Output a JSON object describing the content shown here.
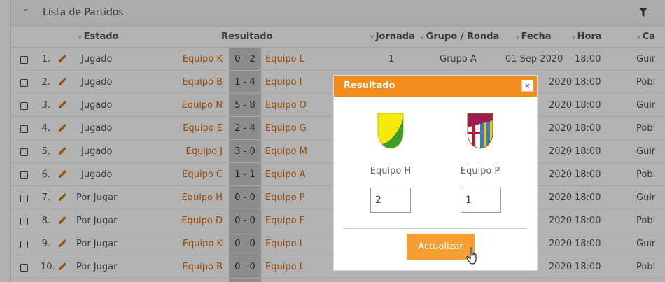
{
  "panel": {
    "title": "Lista de Partidos"
  },
  "columns": {
    "estado": "Estado",
    "resultado": "Resultado",
    "jornada": "Jornada",
    "grupo": "Grupo / Ronda",
    "fecha": "Fecha",
    "hora": "Hora",
    "categoria": "Ca"
  },
  "rows": [
    {
      "num": "1.",
      "estado": "Jugado",
      "local": "Equipo K",
      "score": "0 - 2",
      "visitante": "Equipo L",
      "jornada": "1",
      "grupo": "Grupo A",
      "fecha": "01 Sep 2020",
      "hora": "18:00",
      "categoria": "Guir"
    },
    {
      "num": "2.",
      "estado": "Jugado",
      "local": "Equipo B",
      "score": "1 - 4",
      "visitante": "Equipo I",
      "jornada": "",
      "grupo": "",
      "fecha": "2020",
      "hora": "18:00",
      "categoria": "Pobl"
    },
    {
      "num": "3.",
      "estado": "Jugado",
      "local": "Equipo N",
      "score": "5 - 8",
      "visitante": "Equipo O",
      "jornada": "",
      "grupo": "",
      "fecha": "2020",
      "hora": "18:00",
      "categoria": "Guir"
    },
    {
      "num": "4.",
      "estado": "Jugado",
      "local": "Equipo E",
      "score": "2 - 4",
      "visitante": "Equipo G",
      "jornada": "",
      "grupo": "",
      "fecha": "2020",
      "hora": "18:00",
      "categoria": "Pobl"
    },
    {
      "num": "5.",
      "estado": "Jugado",
      "local": "Equipo J",
      "score": "3 - 0",
      "visitante": "Equipo M",
      "jornada": "",
      "grupo": "",
      "fecha": "2020",
      "hora": "18:00",
      "categoria": "Guir"
    },
    {
      "num": "6.",
      "estado": "Jugado",
      "local": "Equipo C",
      "score": "1 - 1",
      "visitante": "Equipo A",
      "jornada": "",
      "grupo": "",
      "fecha": "2020",
      "hora": "18:00",
      "categoria": "Pobl"
    },
    {
      "num": "7.",
      "estado": "Por Jugar",
      "local": "Equipo H",
      "score": "0 - 0",
      "visitante": "Equipo P",
      "jornada": "",
      "grupo": "",
      "fecha": "2020",
      "hora": "18:00",
      "categoria": "Guir"
    },
    {
      "num": "8.",
      "estado": "Por Jugar",
      "local": "Equipo D",
      "score": "0 - 0",
      "visitante": "Equipo F",
      "jornada": "",
      "grupo": "",
      "fecha": "2020",
      "hora": "18:00",
      "categoria": "Pobl"
    },
    {
      "num": "9.",
      "estado": "Por Jugar",
      "local": "Equipo K",
      "score": "0 - 0",
      "visitante": "Equipo I",
      "jornada": "",
      "grupo": "",
      "fecha": "2020",
      "hora": "18:00",
      "categoria": "Guir"
    },
    {
      "num": "10.",
      "estado": "Por Jugar",
      "local": "Equipo B",
      "score": "0 - 0",
      "visitante": "Equipo L",
      "jornada": "",
      "grupo": "",
      "fecha": "2020",
      "hora": "18:00",
      "categoria": "Pobl"
    }
  ],
  "modal": {
    "title": "Resultado",
    "close_label": "×",
    "home_team": "Equipo H",
    "away_team": "Equipo P",
    "home_score": "2",
    "away_score": "1",
    "update_label": "Actualizar"
  },
  "icons": {
    "panel_toggle": "chevron-up-icon",
    "filter": "filter-icon",
    "edit": "pencil-icon",
    "sort": "chevron-down-icon",
    "home_crest": "team-crest-icon",
    "away_crest": "team-crest-icon",
    "cursor": "hand-pointer-icon"
  },
  "colors": {
    "accent": "#f28c1d",
    "team_link": "#d96b0b",
    "button": "#f59f33",
    "score_column": "#c9c9c9"
  }
}
